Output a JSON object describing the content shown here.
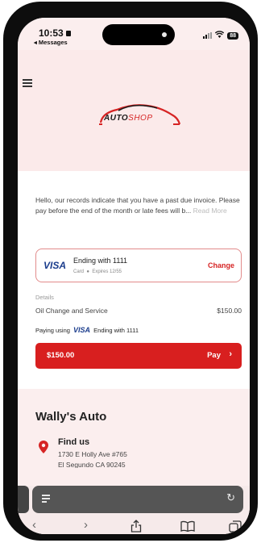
{
  "status_bar": {
    "time": "10:53",
    "back_app": "◂ Messages",
    "battery": "88"
  },
  "header": {
    "logo_text_main": "AUTO",
    "logo_text_accent": "SHOP"
  },
  "invoice": {
    "message": "Hello, our records indicate that you have a past due invoice. Please pay before the end of the month or late fees will b...",
    "read_more": "Read More"
  },
  "card": {
    "brand": "VISA",
    "title": "Ending with 1111",
    "type": "Card",
    "expires": "Expires 12/55",
    "change_label": "Change"
  },
  "details": {
    "label": "Details",
    "service": "Oil Change and Service",
    "price": "$150.00",
    "paying_prefix": "Paying using",
    "paying_brand": "VISA",
    "paying_suffix": "Ending with 1111"
  },
  "pay": {
    "amount": "$150.00",
    "label": "Pay"
  },
  "business": {
    "name": "Wally's Auto",
    "find_us": "Find us",
    "address_line1": "1730 E Holly Ave #765",
    "address_line2": "El Segundo CA 90245"
  },
  "colors": {
    "accent": "#d81f1f",
    "visa_blue": "#1a3c8c",
    "background_pink": "#fbeeee"
  }
}
